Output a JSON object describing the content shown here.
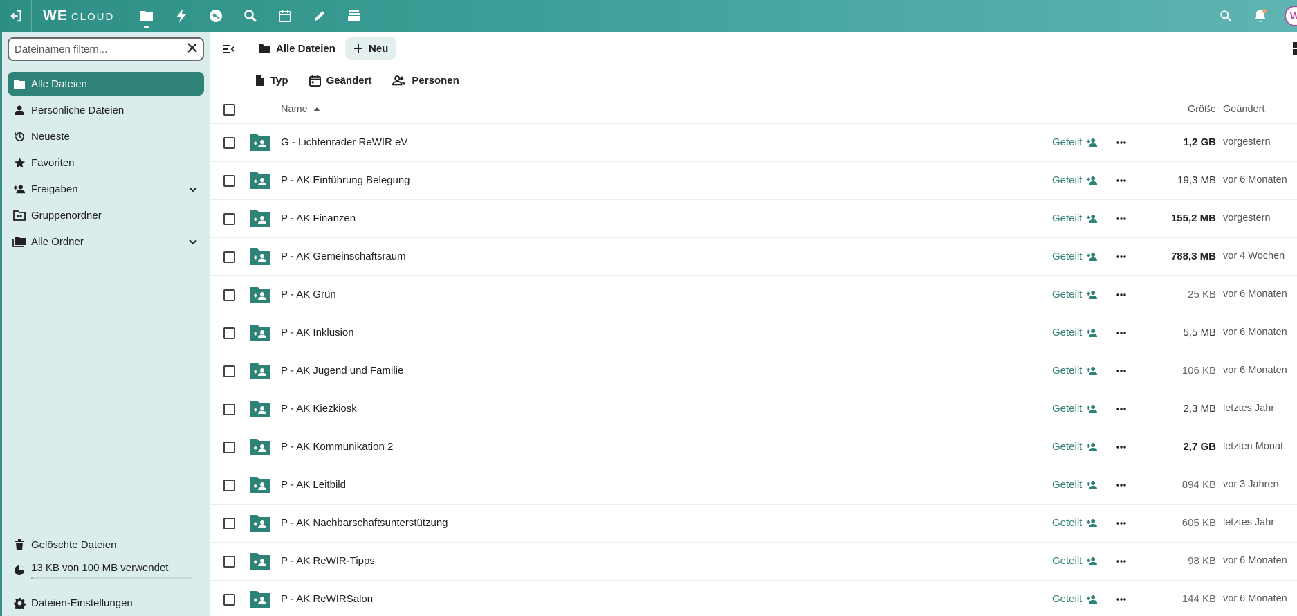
{
  "header": {
    "logo_main": "WE",
    "logo_sub": "CLOUD",
    "avatar_letter": "W"
  },
  "sidebar": {
    "filter_placeholder": "Dateinamen filtern...",
    "items": [
      {
        "label": "Alle Dateien"
      },
      {
        "label": "Persönliche Dateien"
      },
      {
        "label": "Neueste"
      },
      {
        "label": "Favoriten"
      },
      {
        "label": "Freigaben"
      },
      {
        "label": "Gruppenordner"
      },
      {
        "label": "Alle Ordner"
      }
    ],
    "deleted_label": "Gelöschte Dateien",
    "quota_label": "13 KB von 100 MB verwendet",
    "quota_fraction": 0.0001,
    "settings_label": "Dateien-Einstellungen"
  },
  "toolbar": {
    "breadcrumb": "Alle Dateien",
    "new_label": "Neu"
  },
  "filters": {
    "type": "Typ",
    "modified": "Geändert",
    "people": "Personen"
  },
  "table": {
    "col_name": "Name",
    "col_size": "Größe",
    "col_modified": "Geändert",
    "shared_label": "Geteilt",
    "rows": [
      {
        "name": "G - Lichtenrader ReWIR eV",
        "size": "1,2 GB",
        "modified": "vorgestern"
      },
      {
        "name": "P - AK Einführung Belegung",
        "size": "19,3 MB",
        "modified": "vor 6 Monaten"
      },
      {
        "name": "P - AK Finanzen",
        "size": "155,2 MB",
        "modified": "vorgestern"
      },
      {
        "name": "P - AK Gemeinschaftsraum",
        "size": "788,3 MB",
        "modified": "vor 4 Wochen"
      },
      {
        "name": "P - AK Grün",
        "size": "25 KB",
        "modified": "vor 6 Monaten"
      },
      {
        "name": "P - AK Inklusion",
        "size": "5,5 MB",
        "modified": "vor 6 Monaten"
      },
      {
        "name": "P - AK Jugend und Familie",
        "size": "106 KB",
        "modified": "vor 6 Monaten"
      },
      {
        "name": "P - AK Kiezkiosk",
        "size": "2,3 MB",
        "modified": "letztes Jahr"
      },
      {
        "name": "P - AK Kommunikation 2",
        "size": "2,7 GB",
        "modified": "letzten Monat"
      },
      {
        "name": "P - AK Leitbild",
        "size": "894 KB",
        "modified": "vor 3 Jahren"
      },
      {
        "name": "P - AK Nachbarschaftsunterstützung",
        "size": "605 KB",
        "modified": "letztes Jahr"
      },
      {
        "name": "P - AK ReWIR-Tipps",
        "size": "98 KB",
        "modified": "vor 6 Monaten"
      },
      {
        "name": "P - AK ReWIRSalon",
        "size": "144 KB",
        "modified": "vor 6 Monaten"
      }
    ]
  }
}
